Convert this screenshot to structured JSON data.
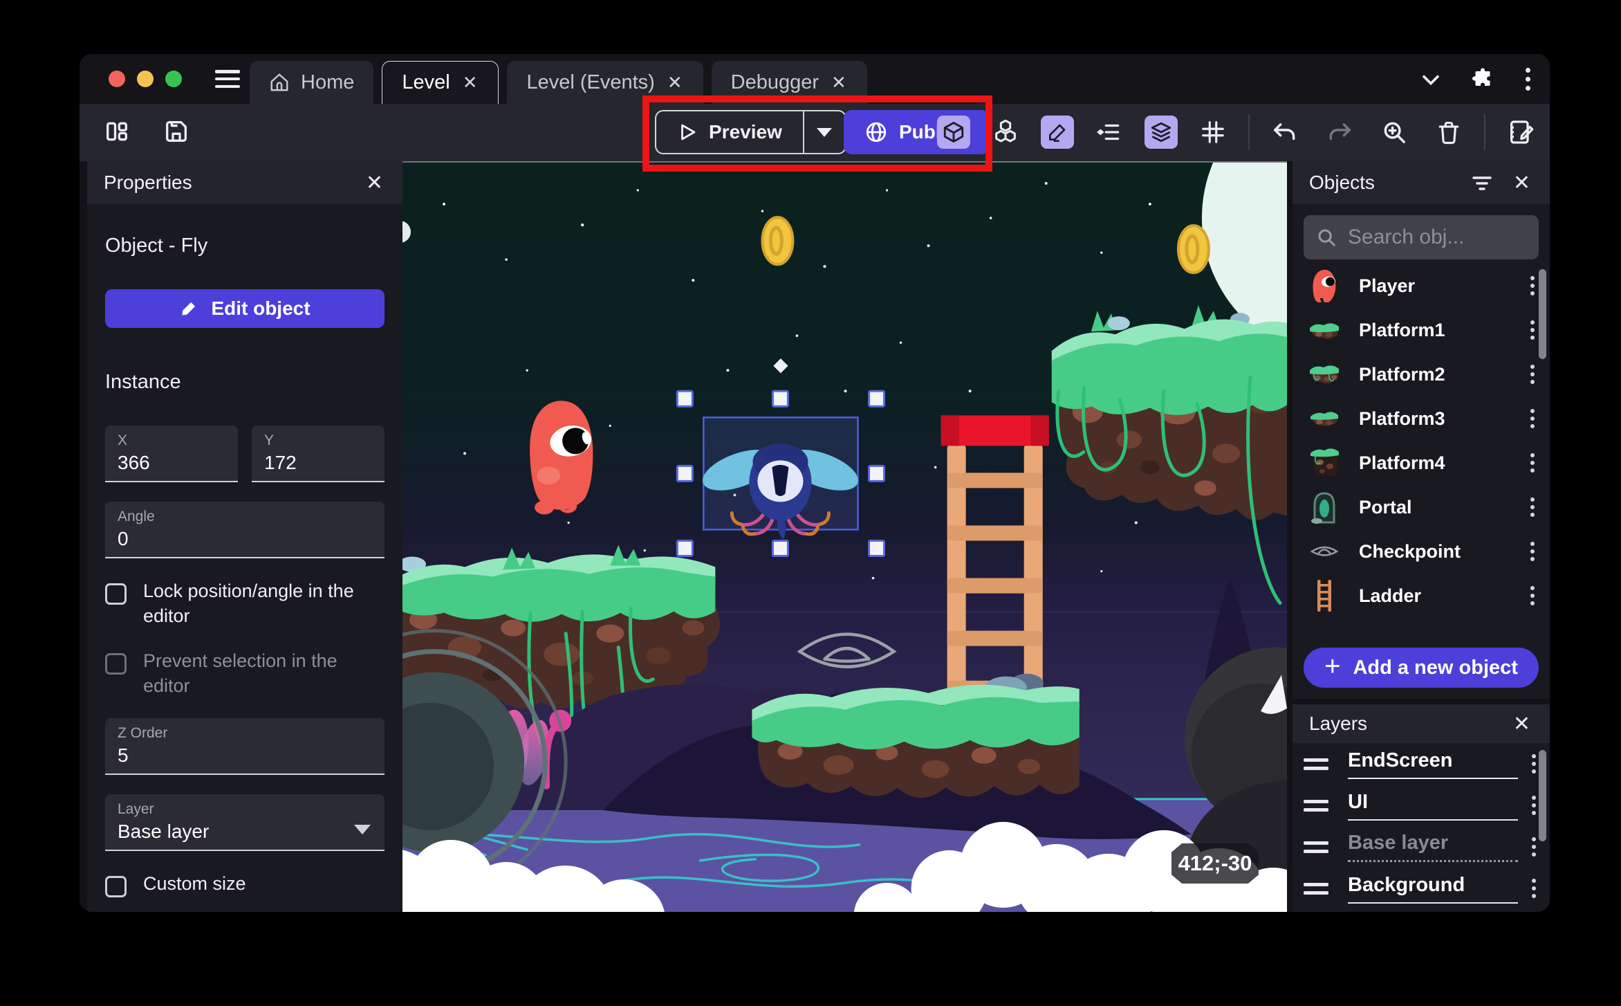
{
  "colors": {
    "accent_purple": "#4d3fd9",
    "toggle_active_lavender": "#b5a8f2",
    "selection_blue": "#5265e0",
    "annotation_red": "#ec1414",
    "panel_bg": "#191920",
    "grass_green": "#47cc88",
    "water_purple": "#5b53a2",
    "water_line_teal": "#3cc4ca"
  },
  "icons": {
    "traffic_lights": "red/yellow/green circles",
    "hamburger-icon": "三",
    "home-icon": "house outline",
    "close-icon": "✕",
    "chevron-down-icon": "⌄",
    "puzzle-icon": "puzzle piece",
    "kebab-icon": "⋮",
    "panels-icon": "split layout",
    "save-icon": "floppy disk",
    "play-icon": "▷",
    "globe-icon": "🌐 wireframe",
    "cube-3d-icon": "isometric cube",
    "objects-cubes-icon": "three cubes",
    "pencil-icon": "pencil",
    "instances-list-icon": "diamond list",
    "layers-stack-icon": "stacked chevrons",
    "grid-icon": "#",
    "undo-icon": "curved arrow left",
    "redo-icon": "curved arrow right",
    "zoom-in-icon": "magnifier plus",
    "trash-icon": "bin",
    "scene-notes-icon": "notebook with pencil",
    "search-icon": "magnifier",
    "filter-icon": "bars",
    "drag-handle-icon": "two bars",
    "plus-icon": "+"
  },
  "tab_bar": {
    "tabs": [
      {
        "label": "Home",
        "active": false,
        "closable": false
      },
      {
        "label": "Level",
        "active": true,
        "closable": true
      },
      {
        "label": "Level (Events)",
        "active": false,
        "closable": true
      },
      {
        "label": "Debugger",
        "active": false,
        "closable": true
      }
    ],
    "close_glyph": "✕"
  },
  "toolbar": {
    "preview_label": "Preview",
    "publish_label": "Publish"
  },
  "properties_panel": {
    "title": "Properties",
    "object_heading": "Object  - Fly",
    "edit_object_label": "Edit object",
    "instance_heading": "Instance",
    "x_label": "X",
    "x_value": "366",
    "y_label": "Y",
    "y_value": "172",
    "angle_label": "Angle",
    "angle_value": "0",
    "lock_label": "Lock position/angle in the editor",
    "prevent_label": "Prevent selection in the editor",
    "z_order_label": "Z Order",
    "z_order_value": "5",
    "layer_label": "Layer",
    "layer_value": "Base layer",
    "custom_size_label": "Custom size"
  },
  "objects_panel": {
    "title": "Objects",
    "search_placeholder": "Search obj...",
    "items": [
      {
        "name": "Player"
      },
      {
        "name": "Platform1"
      },
      {
        "name": "Platform2"
      },
      {
        "name": "Platform3"
      },
      {
        "name": "Platform4"
      },
      {
        "name": "Portal"
      },
      {
        "name": "Checkpoint"
      },
      {
        "name": "Ladder"
      }
    ],
    "add_button_label": "Add a new object"
  },
  "layers_panel": {
    "title": "Layers",
    "layers": [
      {
        "name": "EndScreen",
        "selected": false
      },
      {
        "name": "UI",
        "selected": false
      },
      {
        "name": "Base layer",
        "selected": true
      },
      {
        "name": "Background",
        "selected": false
      }
    ]
  },
  "canvas": {
    "selected_object": "Fly",
    "cursor_coordinates": "412;-30"
  }
}
